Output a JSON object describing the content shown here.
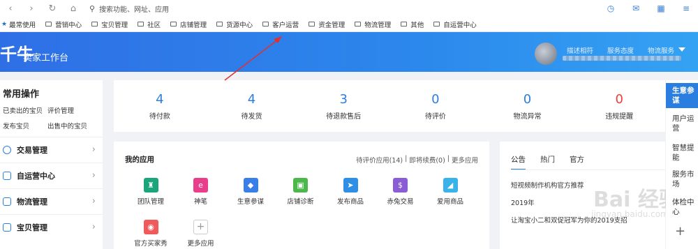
{
  "toolbar": {
    "back_icon": "chevron-left-icon",
    "forward_icon": "chevron-right-icon",
    "search_placeholder": "搜索功能、网址、应用"
  },
  "bookmarks": [
    "最常使用",
    "营销中心",
    "宝贝管理",
    "社区",
    "店铺管理",
    "货源中心",
    "客户运营",
    "资金管理",
    "物流管理",
    "其他",
    "自运营中心"
  ],
  "header": {
    "logo": "千牛",
    "subtitle": "卖家工作台",
    "stats": [
      "描述相符",
      "服务态度",
      "物流服务"
    ]
  },
  "sidebar": {
    "title": "常用操作",
    "quick_links": [
      "已卖出的宝贝",
      "评价管理",
      "发布宝贝",
      "出售中的宝贝"
    ],
    "items": [
      "交易管理",
      "自运营中心",
      "物流管理",
      "宝贝管理"
    ]
  },
  "stats": [
    {
      "value": "4",
      "label": "待付款"
    },
    {
      "value": "4",
      "label": "待发货"
    },
    {
      "value": "3",
      "label": "待退款售后"
    },
    {
      "value": "0",
      "label": "待评价"
    },
    {
      "value": "0",
      "label": "物流异常"
    },
    {
      "value": "0",
      "label": "违规提醒"
    }
  ],
  "apps": {
    "title": "我的应用",
    "links": [
      "待评价应用(14)",
      "|",
      "即将续费(0)",
      "|",
      "更多应用"
    ],
    "items": [
      {
        "label": "团队管理",
        "color": "#1aa57a"
      },
      {
        "label": "神笔",
        "color": "#e83e8c"
      },
      {
        "label": "生意参谋",
        "color": "#3a7fe8"
      },
      {
        "label": "店铺诊断",
        "color": "#4cb84c"
      },
      {
        "label": "发布商品",
        "color": "#2d8fe6"
      },
      {
        "label": "赤兔交易",
        "color": "#8a5cd6"
      },
      {
        "label": "爱用商品",
        "color": "#3ab2ea"
      },
      {
        "label": "官方买家秀",
        "color": "#ef5a5a"
      },
      {
        "label": "更多应用",
        "color": "#ffffff"
      }
    ]
  },
  "notice": {
    "tabs": [
      "公告",
      "热门",
      "官方"
    ],
    "items": [
      "短视频制作机构官方推荐",
      "2019年",
      "让淘宝小二和双促冠军为你的2019支招"
    ]
  },
  "rail": [
    "生意参谋",
    "用户运营",
    "智慧提能",
    "服务市场",
    "体检中心"
  ],
  "watermark": {
    "line1": "Bai 经验",
    "line2": "jingyan.baidu.com"
  }
}
